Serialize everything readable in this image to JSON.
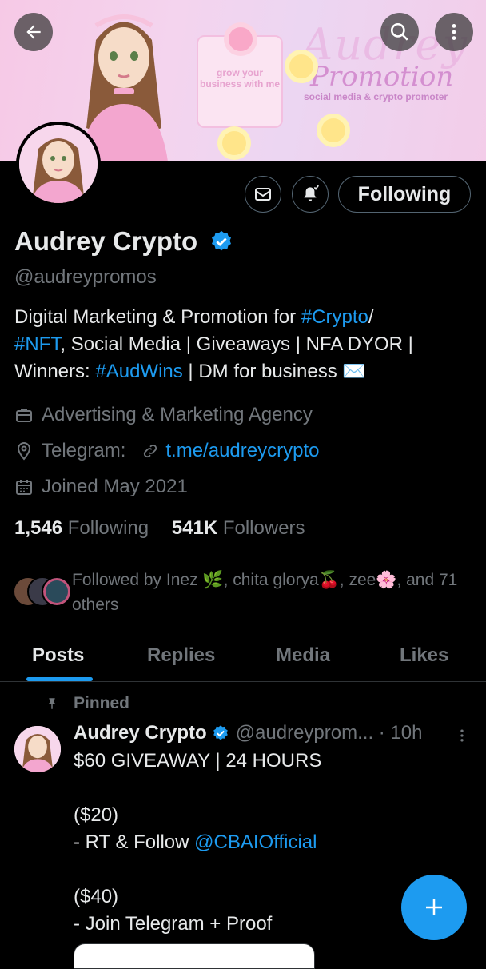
{
  "banner": {
    "deco_text": "Audrey",
    "title": "Promotion",
    "subtitle": "social media & crypto promoter",
    "card_text": "grow your business with me"
  },
  "profile": {
    "name": "Audrey Crypto",
    "handle": "@audreypromos",
    "bio": {
      "p1": "Digital Marketing & Promotion for ",
      "tag1": "#Crypto",
      "p2": "/",
      "tag2": "#NFT",
      "p3": ", Social Media | Giveaways | NFA DYOR |",
      "p4": "Winners: ",
      "tag3": "#AudWins",
      "p5": " | DM for business ✉️"
    },
    "category": "Advertising & Marketing Agency",
    "location_label": "Telegram:",
    "link": "t.me/audreycrypto",
    "joined": "Joined May 2021",
    "following_count": "1,546",
    "following_label": "Following",
    "followers_count": "541K",
    "followers_label": "Followers",
    "followed_by": "Followed by Inez 🌿, chita glorya🍒, zee🌸, and 71 others"
  },
  "buttons": {
    "follow": "Following"
  },
  "tabs": [
    "Posts",
    "Replies",
    "Media",
    "Likes"
  ],
  "post": {
    "pinned_label": "Pinned",
    "author": "Audrey Crypto",
    "handle_time": "@audreyprom... · 10h",
    "line1": "$60 GIVEAWAY | 24 HOURS",
    "line2": "($20)",
    "line3": "- RT & Follow ",
    "mention": "@CBAIOfficial",
    "line4": "($40)",
    "line5": "- Join Telegram + Proof"
  },
  "colors": {
    "accent": "#1d9bf0",
    "muted": "#71767b",
    "text": "#e7e9ea",
    "background": "#000000"
  },
  "icons": [
    "back-arrow-icon",
    "search-icon",
    "more-vertical-icon",
    "mail-icon",
    "bell-add-icon",
    "verified-badge-icon",
    "briefcase-icon",
    "location-pin-icon",
    "link-icon",
    "calendar-icon",
    "pin-icon",
    "plus-icon"
  ]
}
